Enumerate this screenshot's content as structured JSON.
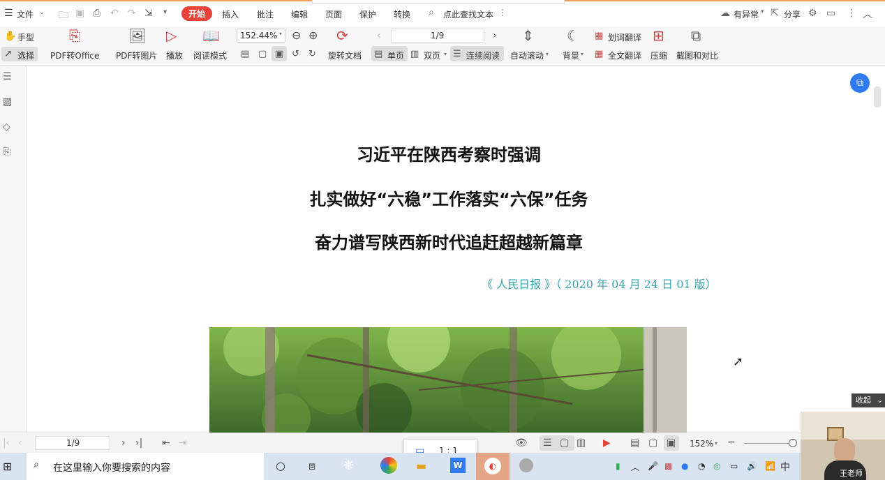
{
  "menubar": {
    "file": "文件",
    "tabs": [
      "开始",
      "插入",
      "批注",
      "编辑",
      "页面",
      "保护",
      "转换"
    ],
    "active_tab": "开始",
    "search_label": "点此查找文本",
    "sync_label": "有异常",
    "share_label": "分享"
  },
  "toolbar": {
    "hand": "手型",
    "select": "选择",
    "pdf_to_office": "PDF转Office",
    "pdf_to_image": "PDF转图片",
    "play": "播放",
    "read_mode": "阅读模式",
    "zoom_value": "152.44%",
    "page_indicator": "1/9",
    "rotate": "旋转文档",
    "single_page": "单页",
    "double_page": "双页",
    "continuous": "连续阅读",
    "auto_scroll": "自动滚动",
    "background": "背景",
    "word_translate": "划词翻译",
    "full_translate": "全文翻译",
    "compress": "压缩",
    "screenshot_compare": "截图和对比"
  },
  "document": {
    "title_lines": [
      "习近平在陕西考察时强调",
      "扎实做好“六稳”工作落实“六保”任务",
      "奋力谱写陕西新时代追赶超越新篇章"
    ],
    "source": "《 人民日报 》（ 2020 年 04 月 24 日 01 版）"
  },
  "statusbar": {
    "page_indicator": "1/9",
    "zoom_value": "152%",
    "collapse_label": "收起",
    "ratio_popup": "1 : 1"
  },
  "taskbar": {
    "search_placeholder": "在这里输入你要搜索的内容",
    "ime": "中",
    "webcam_name": "王老师"
  },
  "colors": {
    "accent_red": "#e8423a",
    "source_teal": "#3aa7b0",
    "taskbar_bg": "#d9e4f1"
  }
}
